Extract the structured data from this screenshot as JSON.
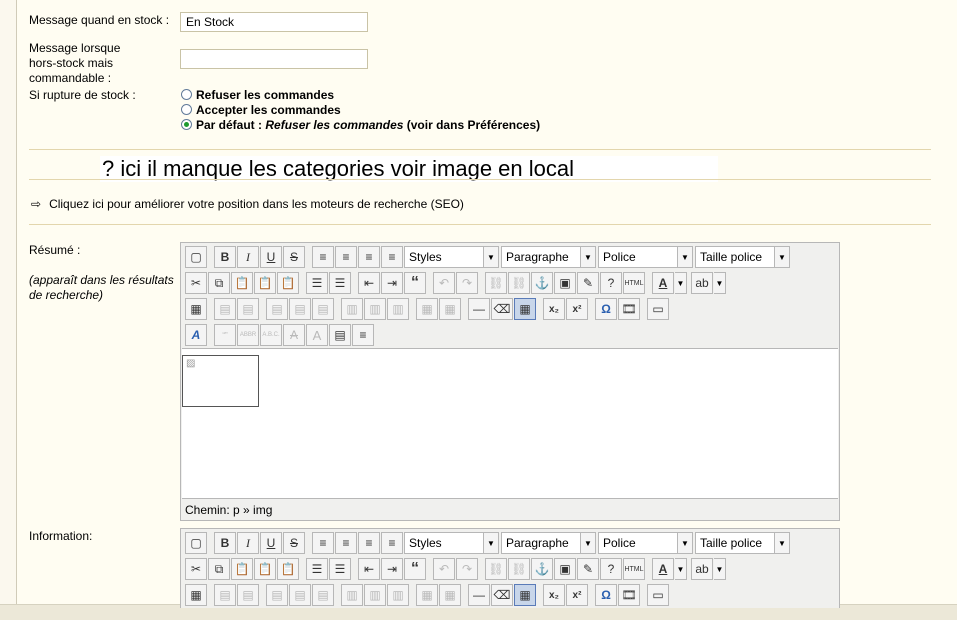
{
  "fields": {
    "instock_label": "Message quand en stock :",
    "instock_value": "En Stock",
    "outofstock_label_1": "Message lorsque",
    "outofstock_label_2": "hors-stock mais",
    "outofstock_label_3": "commandable :",
    "outofstock_value": "",
    "rupture_label": "Si rupture de stock :",
    "options": [
      {
        "label": "Refuser les commandes",
        "selected": false
      },
      {
        "label": "Accepter les commandes",
        "selected": false
      },
      {
        "prefix": "Par défaut :",
        "italic": "Refuser les commandes",
        "suffix": "(voir dans Préférences)",
        "selected": true
      }
    ]
  },
  "note": "? ici il manque les categories voir image en local",
  "seo_link": "Cliquez ici pour améliorer votre position dans les moteurs de recherche (SEO)",
  "resume": {
    "label": "Résumé :",
    "hint_1": "(apparaît dans les résultats",
    "hint_2": "de recherche)"
  },
  "information": {
    "label": "Information:"
  },
  "editor": {
    "styles": "Styles",
    "paragraph": "Paragraphe",
    "font": "Police",
    "font_size": "Taille police",
    "path": "Chemin: p » img",
    "icons": {
      "bold": "B",
      "italic": "I",
      "underline": "U",
      "strike": "S",
      "quote": "“",
      "omega": "Ω",
      "subscript": "x₂",
      "superscript": "x²",
      "font_color": "A",
      "abbr": "“”",
      "acronym": "ABBR",
      "abc": "A.B.C.",
      "attribs": "A"
    }
  }
}
